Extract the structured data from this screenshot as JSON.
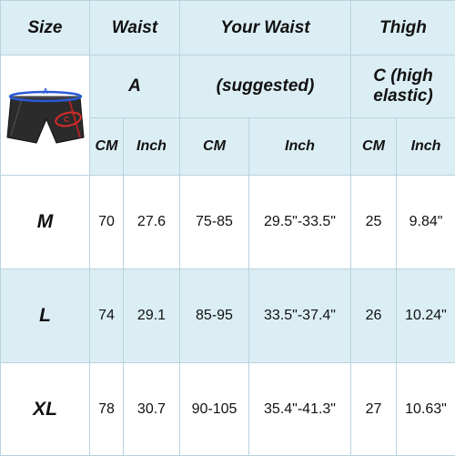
{
  "header": {
    "size": "Size",
    "waist": "Waist",
    "your_waist": "Your Waist",
    "thigh": "Thigh"
  },
  "subheader": {
    "product_image_icon": "cycling-shorts-icon",
    "waist_code": "A",
    "your_waist_note": "(suggested)",
    "thigh_code": "C (high elastic)",
    "image_markers": [
      "A",
      "C"
    ]
  },
  "units": {
    "waist_cm": "CM",
    "waist_inch": "Inch",
    "your_waist_cm": "CM",
    "your_waist_inch": "Inch",
    "thigh_cm": "CM",
    "thigh_inch": "Inch"
  },
  "rows": [
    {
      "size": "M",
      "waist_cm": "70",
      "waist_inch": "27.6",
      "your_waist_cm": "75-85",
      "your_waist_inch": "29.5\"-33.5\"",
      "thigh_cm": "25",
      "thigh_inch": "9.84\""
    },
    {
      "size": "L",
      "waist_cm": "74",
      "waist_inch": "29.1",
      "your_waist_cm": "85-95",
      "your_waist_inch": "33.5\"-37.4\"",
      "thigh_cm": "26",
      "thigh_inch": "10.24\""
    },
    {
      "size": "XL",
      "waist_cm": "78",
      "waist_inch": "30.7",
      "your_waist_cm": "90-105",
      "your_waist_inch": "35.4\"-41.3\"",
      "thigh_cm": "27",
      "thigh_inch": "10.63\""
    }
  ],
  "colors": {
    "header_fill": "#dbeef4",
    "border": "#b8d3de",
    "text": "#111111",
    "waistband_marker": "#2a5bd7",
    "thigh_marker": "#d62b2b"
  }
}
